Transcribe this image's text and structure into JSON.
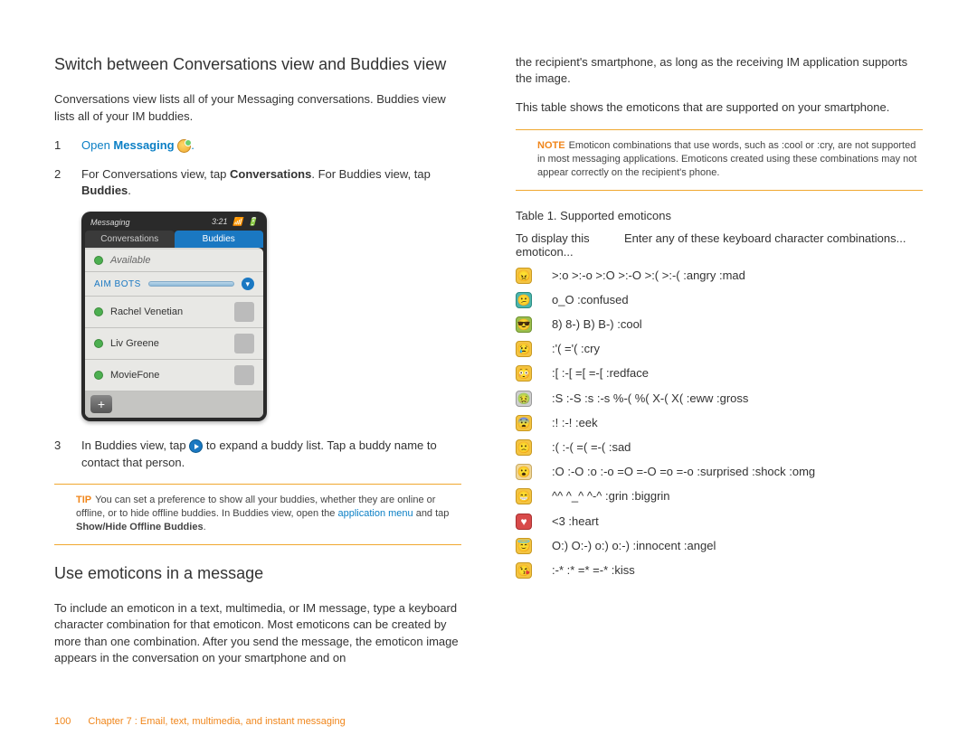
{
  "left": {
    "h_switch": "Switch between Conversations view and Buddies view",
    "switch_intro": "Conversations view lists all of your Messaging conversations. Buddies view lists all of your IM buddies.",
    "step1_pre": "Open ",
    "step1_bold": "Messaging",
    "step1_post": " ",
    "step1_end": ".",
    "step2_a": "For Conversations view, tap ",
    "step2_b": "Conversations",
    "step2_c": ". For Buddies view, tap ",
    "step2_d": "Buddies",
    "step2_e": ".",
    "step3_a": "In Buddies view, tap ",
    "step3_b": " to expand a buddy list. Tap a buddy name to contact that person.",
    "tip_label": "TIP",
    "tip_a": "You can set a preference to show all your buddies, whether they are online or offline, or to hide offline buddies. In Buddies view, open the ",
    "tip_link": "application menu",
    "tip_b": " and tap ",
    "tip_bold": "Show/Hide Offline Buddies",
    "tip_c": ".",
    "h_emoticons": "Use emoticons in a message",
    "emo_intro": "To include an emoticon in a text, multimedia, or IM message, type a keyboard character combination for that emoticon. Most emoticons can be created by more than one combination. After you send the message, the emoticon image appears in the conversation on your smartphone and on"
  },
  "screenshot": {
    "title": "Messaging",
    "time": "3:21",
    "tab_conv": "Conversations",
    "tab_bud": "Buddies",
    "available": "Available",
    "section": "AIM BOTS",
    "b1": "Rachel Venetian",
    "b2": "Liv Greene",
    "b3": "MovieFone"
  },
  "right": {
    "cont": "the recipient's smartphone, as long as the receiving IM application supports the image.",
    "intro2": "This table shows the emoticons that are supported on your smartphone.",
    "note_label": "NOTE",
    "note_text": "Emoticon combinations that use words, such as :cool or :cry, are not supported in most messaging applications. Emoticons created using these combinations may not appear correctly on the recipient's phone.",
    "table_caption": "Table 1.  Supported emoticons",
    "col1": "To display this emoticon...",
    "col2": "Enter any of these keyboard character combinations..."
  },
  "emoticons": [
    {
      "cls": "e-yellow",
      "face": "😠",
      "text": ">:o    >:-o    >:O    >:-O    >:(    >:-(    :angry    :mad"
    },
    {
      "cls": "e-teal",
      "face": "😕",
      "text": "o_O    :confused"
    },
    {
      "cls": "e-green",
      "face": "😎",
      "text": "8)    8-)    B)    B-)    :cool"
    },
    {
      "cls": "e-yellow",
      "face": "😢",
      "text": ":'(    ='(    :cry"
    },
    {
      "cls": "e-yellow",
      "face": "😳",
      "text": ":[    :-[    =[    =-[    :redface"
    },
    {
      "cls": "e-grey",
      "face": "🤢",
      "text": ":S    :-S    :s    :-s    %-(    %(    X-(    X(    :eww    :gross"
    },
    {
      "cls": "e-yellow",
      "face": "😨",
      "text": ":!    :-!    :eek"
    },
    {
      "cls": "e-yellow",
      "face": "🙁",
      "text": ":(    :-(    =(    =-(    :sad"
    },
    {
      "cls": "e-pale",
      "face": "😮",
      "text": ":O    :-O    :o    :-o    =O    =-O    =o    =-o    :surprised    :shock    :omg"
    },
    {
      "cls": "e-yellow",
      "face": "😁",
      "text": "^^    ^_^    ^-^    :grin    :biggrin"
    },
    {
      "cls": "e-red",
      "face": "♥",
      "text": "<3    :heart"
    },
    {
      "cls": "e-yellow",
      "face": "😇",
      "text": "O:)    O:-)    o:)    o:-)    :innocent    :angel"
    },
    {
      "cls": "e-yellow",
      "face": "😘",
      "text": ":-*    :*    =*    =-*    :kiss"
    }
  ],
  "footer": {
    "page": "100",
    "chapter": "Chapter 7 : Email, text, multimedia, and instant messaging"
  }
}
